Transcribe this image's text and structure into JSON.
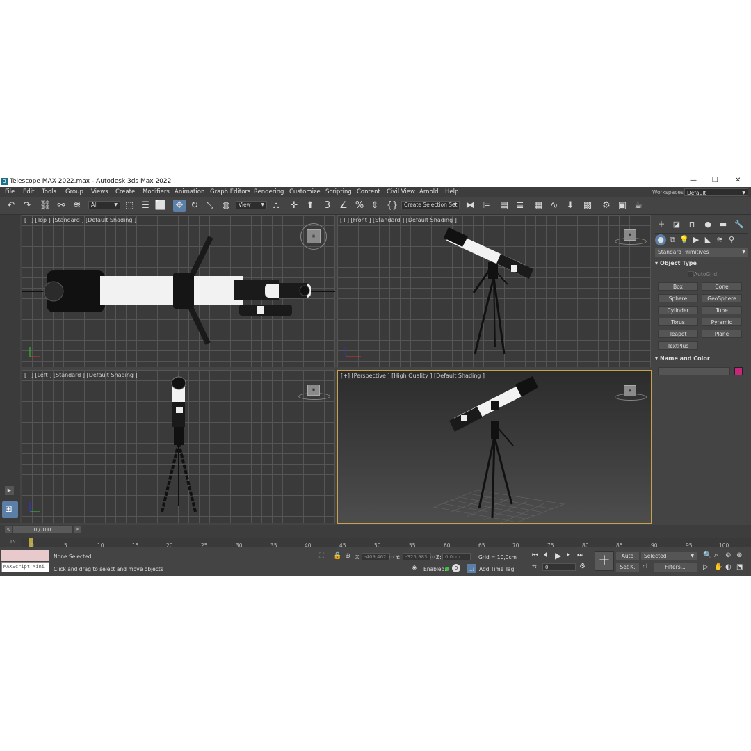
{
  "window": {
    "title": "Telescope MAX 2022.max - Autodesk 3ds Max 2022",
    "app_icon": "3"
  },
  "menu": [
    "File",
    "Edit",
    "Tools",
    "Group",
    "Views",
    "Create",
    "Modifiers",
    "Animation",
    "Graph Editors",
    "Rendering",
    "Customize",
    "Scripting",
    "Content",
    "Civil View",
    "Arnold",
    "Help"
  ],
  "workspaces": {
    "label": "Workspaces:",
    "value": "Default"
  },
  "toolbar": {
    "filter_value": "All",
    "refcoord_value": "View",
    "selection_set_value": "Create Selection Set"
  },
  "viewports": {
    "top": "[+] [Top ] [Standard ] [Default Shading ]",
    "front": "[+] [Front ] [Standard ] [Default Shading ]",
    "left": "[+] [Left ] [Standard ] [Default Shading ]",
    "perspective": "[+] [Perspective ] [High Quality ] [Default Shading ]"
  },
  "command_panel": {
    "category_value": "Standard Primitives",
    "object_type_title": "Object Type",
    "autogrid_label": "AutoGrid",
    "primitives": [
      "Box",
      "Cone",
      "Sphere",
      "GeoSphere",
      "Cylinder",
      "Tube",
      "Torus",
      "Pyramid",
      "Teapot",
      "Plane",
      "TextPlus"
    ],
    "name_color_title": "Name and Color",
    "object_color": "#c5287a"
  },
  "timeline": {
    "frame_counter": "0 / 100",
    "ticks": [
      "0",
      "5",
      "10",
      "15",
      "20",
      "25",
      "30",
      "35",
      "40",
      "45",
      "50",
      "55",
      "60",
      "65",
      "70",
      "75",
      "80",
      "85",
      "90",
      "95",
      "100"
    ],
    "current_frame": 0
  },
  "status": {
    "maxscript_label": "MAXScript Mini",
    "selection": "None Selected",
    "prompt": "Click and drag to select and move objects",
    "x_label": "X:",
    "x_value": "-409,462cm",
    "y_label": "Y:",
    "y_value": "-325,983cm",
    "z_label": "Z:",
    "z_value": "0,0cm",
    "grid": "Grid = 10,0cm",
    "enabled_label": "Enabled:",
    "add_time_tag": "Add Time Tag",
    "auto_label": "Auto",
    "key_mode_value": "Selected",
    "set_key_label": "Set K.",
    "filters_label": "Filters...",
    "frame_value": "0"
  },
  "colors": {
    "active_tool": "#5b7fa6",
    "active_viewport_border": "#c8a24a",
    "maxscript_bg": "#e8c9cc"
  }
}
